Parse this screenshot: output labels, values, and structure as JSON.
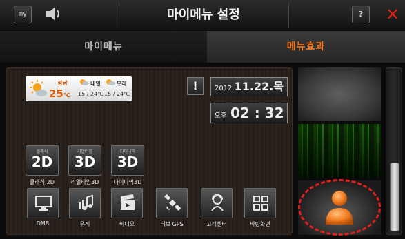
{
  "header": {
    "my_label": "my",
    "title": "마이메뉴 설정",
    "help_label": "?",
    "close_label": "✕"
  },
  "tabs": [
    {
      "label": "마이메뉴",
      "active": false
    },
    {
      "label": "메뉴효과",
      "active": true
    }
  ],
  "weather": {
    "city": "성남",
    "temp": "25",
    "unit": "℃",
    "tomorrow": {
      "label": "내일",
      "temps": "15 / 24℃"
    },
    "day_after": {
      "label": "모레",
      "temps": "15 / 24℃"
    }
  },
  "alert_label": "!",
  "date": {
    "prefix": "2012.",
    "day": "11.22.목"
  },
  "time": {
    "ampm": "오후",
    "value": "02 : 32"
  },
  "modes": [
    {
      "small": "클래식",
      "big": "2D",
      "label": "클래식 2D"
    },
    {
      "small": "리얼타임",
      "big": "3D",
      "label": "리얼타임3D"
    },
    {
      "small": "다이나믹",
      "big": "3D",
      "label": "다이나믹3D"
    }
  ],
  "apps": [
    {
      "icon": "tv-icon",
      "label": "DMB"
    },
    {
      "icon": "music-icon",
      "label": "뮤직"
    },
    {
      "icon": "clapperboard-icon",
      "label": "비디오"
    },
    {
      "icon": "satellite-icon",
      "label": "터보 GPS"
    },
    {
      "icon": "customer-center-icon",
      "label": "고객센터"
    },
    {
      "icon": "grid-icon",
      "label": "바탕화면"
    }
  ],
  "colors": {
    "accent_orange": "#ff7a1a",
    "close_red": "#e02010",
    "highlight_red": "#e0201a"
  }
}
